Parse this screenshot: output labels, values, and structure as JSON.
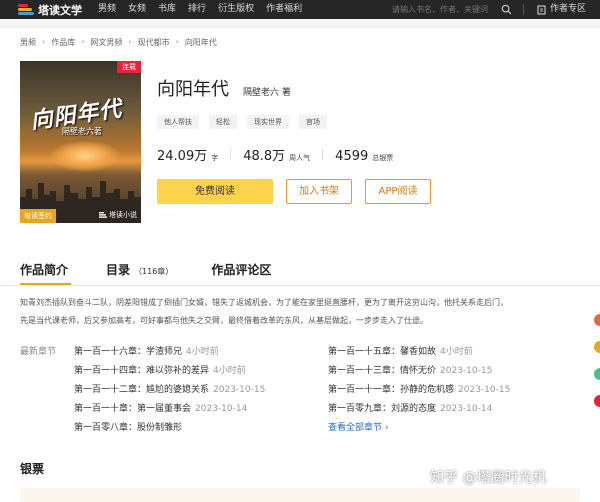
{
  "topbar": {
    "brand": "塔读文学",
    "nav": [
      "男频",
      "女频",
      "书库",
      "排行",
      "衍生版权",
      "作者福利"
    ],
    "search_placeholder": "请输入书名、作者、关键词",
    "author_zone": "作者专区"
  },
  "breadcrumb": [
    "男频",
    "作品库",
    "网文男频",
    "现代都市",
    "向阳年代"
  ],
  "cover": {
    "title": "向阳年代",
    "author": "隔壁老六著",
    "badge": "连载",
    "sign": "塔读签约",
    "brand": "塔读小说"
  },
  "book": {
    "title": "向阳年代",
    "author": "隔壁老六 著",
    "tags": [
      "他人帮扶",
      "轻松",
      "现实世界",
      "官场"
    ],
    "word_count": "24.09万",
    "word_unit": "字",
    "popularity": "48.8万",
    "popularity_unit": "周人气",
    "tickets": "4599",
    "tickets_unit": "总银票"
  },
  "buttons": {
    "read": "免费阅读",
    "shelf": "加入书架",
    "app": "APP阅读"
  },
  "tabs": {
    "intro": "作品简介",
    "catalog": "目录",
    "catalog_count": "（116章）",
    "reviews": "作品评论区"
  },
  "intro_lines": [
    "知青刘杰插队到奋斗二队，阴差阳错成了倒插门女婿，错失了返城机会，为了能在家里挺直腰杆，更为了离开这穷山沟，他托关系走后门，",
    "先是当代课老师，后又参加高考，可好事都与他失之交臂，最终借着改革的东风，从基层做起，一步步走入了仕途。"
  ],
  "latest": {
    "label": "最新章节",
    "chapters": [
      {
        "title": "第一百一十六章：学渣师兄",
        "time": "4小时前"
      },
      {
        "title": "第一百一十五章：馨香如故",
        "time": "4小时前"
      },
      {
        "title": "第一百一十四章：难以弥补的差异",
        "time": "4小时前"
      },
      {
        "title": "第一百一十三章：情怀无价",
        "time": "2023-10-15"
      },
      {
        "title": "第一百一十二章：尴尬的婆媳关系",
        "time": "2023-10-15"
      },
      {
        "title": "第一百一十一章：孙静的危机感",
        "time": "2023-10-15"
      },
      {
        "title": "第一百一十章：第一届董事会",
        "time": "2023-10-14"
      },
      {
        "title": "第一百零九章：刘源的态度",
        "time": "2023-10-14"
      },
      {
        "title": "第一百零八章：股份制雏形",
        "time": "2023-10-14"
      }
    ],
    "all_link": "查看全部章节 ›"
  },
  "silver_title": "银票",
  "watermark": "知乎 @塔圈时光机",
  "colors": {
    "accent": "#ffd24d",
    "outline": "#e8992c",
    "link": "#2a6fbb",
    "tab_underline": "#e8a620"
  },
  "side_dots": [
    "#f0603a",
    "#e8a620",
    "#4cbf8a",
    "#e5243c"
  ]
}
